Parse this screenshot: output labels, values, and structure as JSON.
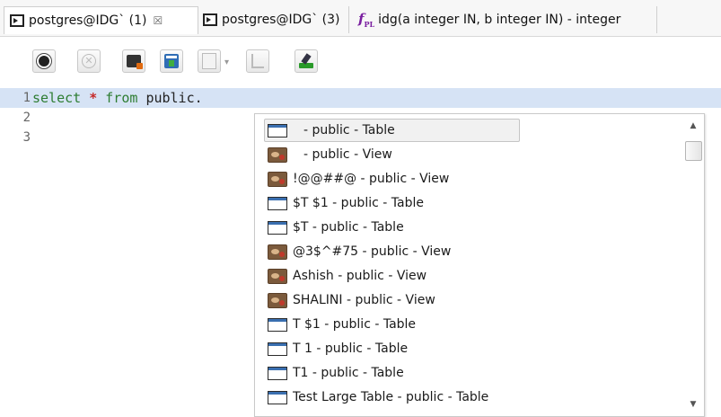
{
  "tabs": [
    {
      "label": "postgres@IDG` (1)",
      "close": "☒",
      "icon": "sql-editor-icon",
      "active": true
    },
    {
      "label": "postgres@IDG` (3)",
      "icon": "sql-editor-icon",
      "active": false
    },
    {
      "label": "idg(a integer IN, b integer IN) - integer",
      "icon": "function-icon",
      "icon_text": "f",
      "icon_sub": "PL",
      "active": false
    }
  ],
  "toolbar": {
    "buttons": [
      "execute-icon",
      "cancel-icon",
      "explain-plan-icon",
      "export-results-icon",
      "history-icon",
      "format-icon",
      "clear-icon"
    ],
    "dropdown_arrow": "▾",
    "cancel_glyph": "✕"
  },
  "editor": {
    "lines": [
      {
        "number": "1",
        "kw1": "select",
        "star": "*",
        "kw2": "from",
        "rest": "public."
      },
      {
        "number": "2"
      },
      {
        "number": "3"
      }
    ],
    "colors": {
      "keyword": "#2e7d32",
      "star": "#c62828",
      "current_line": "#d6e3f5"
    }
  },
  "completion": {
    "items": [
      {
        "label": " - public - Table",
        "kind": "table"
      },
      {
        "label": " - public - View",
        "kind": "view"
      },
      {
        "label": "!@@##@ - public - View",
        "kind": "view"
      },
      {
        "label": "$T $1 - public - Table",
        "kind": "table"
      },
      {
        "label": "$T - public - Table",
        "kind": "table"
      },
      {
        "label": "@3$^#75 - public - View",
        "kind": "view"
      },
      {
        "label": "Ashish - public - View",
        "kind": "view"
      },
      {
        "label": "SHALINI - public - View",
        "kind": "view"
      },
      {
        "label": "T $1 - public - Table",
        "kind": "table"
      },
      {
        "label": "T 1 - public - Table",
        "kind": "table"
      },
      {
        "label": "T1 - public - Table",
        "kind": "table"
      },
      {
        "label": "Test Large Table - public - Table",
        "kind": "table"
      }
    ],
    "selected_index": 0,
    "scroll_position": 0.05,
    "scroll_up": "▲",
    "scroll_down": "▼"
  }
}
